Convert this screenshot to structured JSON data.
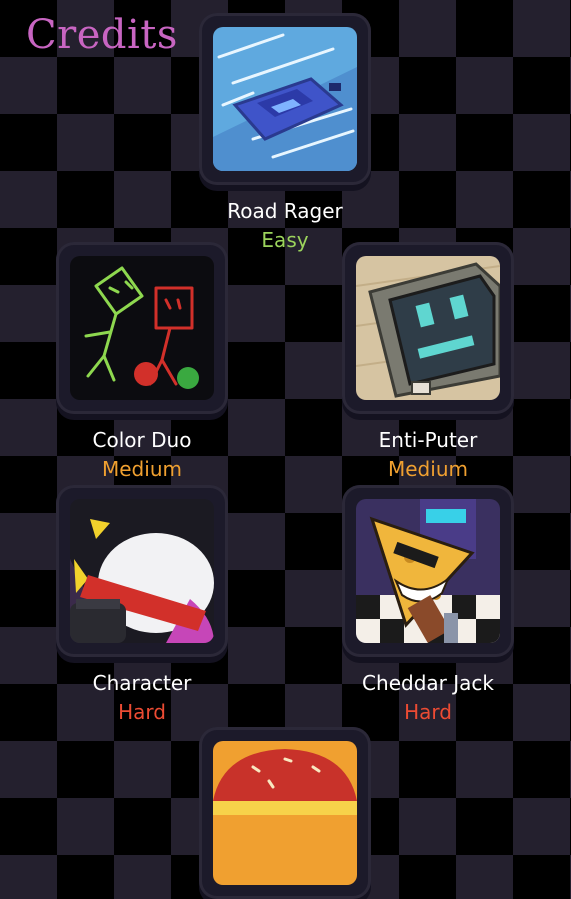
{
  "header": {
    "credits_label": "Credits"
  },
  "colors": {
    "easy": "#9bd35c",
    "medium": "#f0a030",
    "hard": "#ec4b33"
  },
  "levels": [
    {
      "title": "Road Rager",
      "difficulty": "Easy",
      "icon": "car-on-road-art"
    },
    {
      "title": "Color Duo",
      "difficulty": "Medium",
      "icon": "green-and-red-doodles-art"
    },
    {
      "title": "Enti-Puter",
      "difficulty": "Medium",
      "icon": "computer-face-art"
    },
    {
      "title": "Character",
      "difficulty": "Hard",
      "icon": "white-ball-red-band-art"
    },
    {
      "title": "Cheddar Jack",
      "difficulty": "Hard",
      "icon": "cheese-character-art"
    },
    {
      "title": "",
      "difficulty": "",
      "icon": "burger-art"
    }
  ]
}
